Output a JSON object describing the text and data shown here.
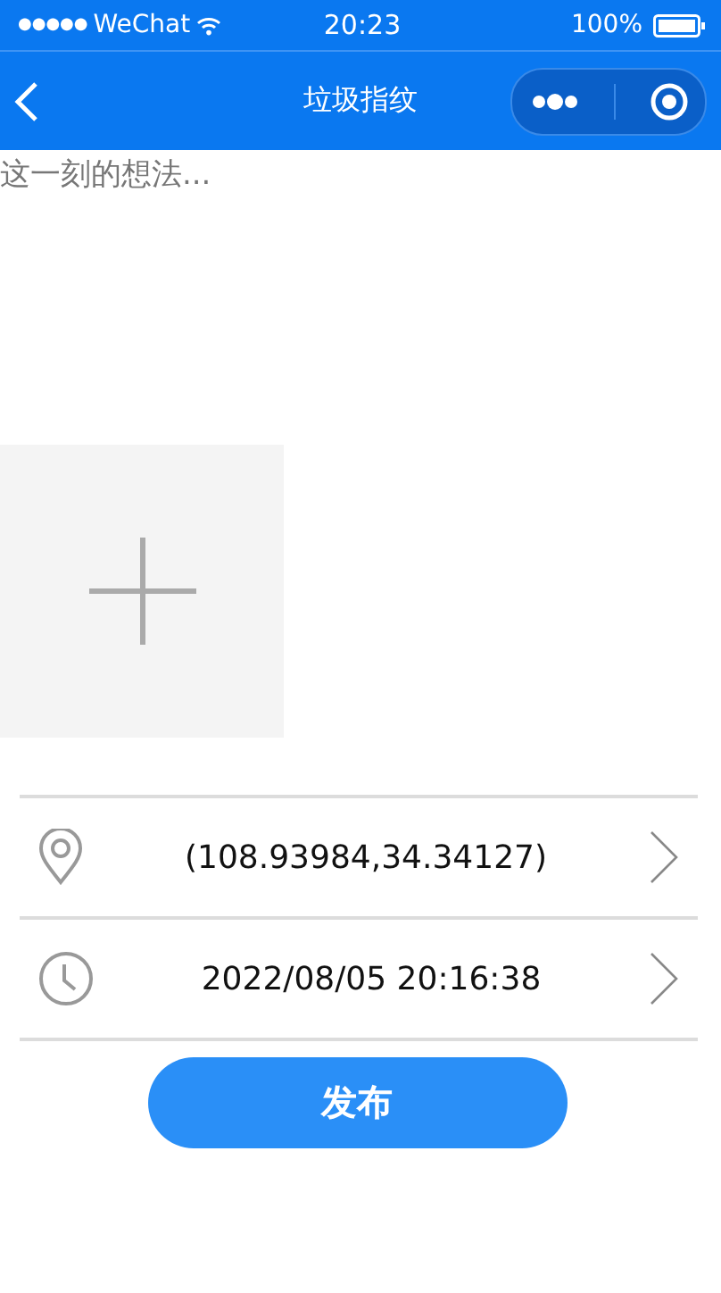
{
  "status_bar": {
    "signal_dots": "●●●●●",
    "carrier": "WeChat",
    "time": "20:23",
    "battery": "100%"
  },
  "nav": {
    "title": "垃圾指纹"
  },
  "post": {
    "placeholder": "这一刻的想法..."
  },
  "info_rows": [
    {
      "kind": "location",
      "value": "(108.93984,34.34127)"
    },
    {
      "kind": "time",
      "value": "2022/08/05 20:16:38"
    }
  ],
  "submit": {
    "label": "发布"
  }
}
